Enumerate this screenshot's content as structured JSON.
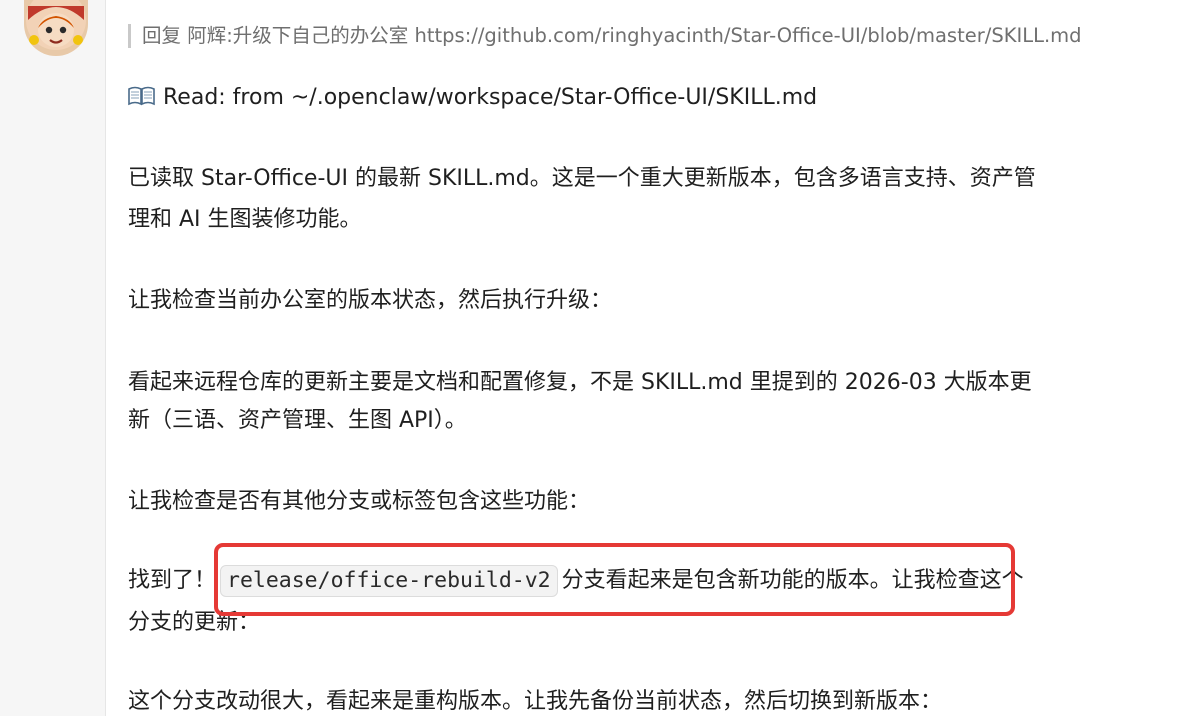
{
  "quote": {
    "reply_prefix": "回复 阿辉:",
    "text": "升级下自己的办公室",
    "link": "https://github.com/ringhyacinth/Star-Office-UI/blob/master/SKILL.md"
  },
  "messages": {
    "read_line": {
      "icon": "open-book-icon",
      "text": "Read: from ~/.openclaw/workspace/Star-Office-UI/SKILL.md"
    },
    "p1_line1": "已读取 Star-Office-UI 的最新 SKILL.md。这是一个重大更新版本，包含多语言支持、资产管",
    "p1_line2": "理和 AI 生图装修功能。",
    "p2": "让我检查当前办公室的版本状态，然后执行升级：",
    "p3_line1": "看起来远程仓库的更新主要是文档和配置修复，不是 SKILL.md 里提到的 2026-03 大版本更",
    "p3_line2": "新（三语、资产管理、生图 API）。",
    "p4": "让我检查是否有其他分支或标签包含这些功能：",
    "p5_prefix": "找到了！",
    "p5_code": "release/office-rebuild-v2",
    "p5_suffix": "分支看起来是包含新功能的版本。让我检查这个",
    "p5_line2": "分支的更新：",
    "p6": "这个分支改动很大，看起来是重构版本。让我先备份当前状态，然后切换到新版本："
  },
  "highlight": {
    "color": "#e53935"
  }
}
